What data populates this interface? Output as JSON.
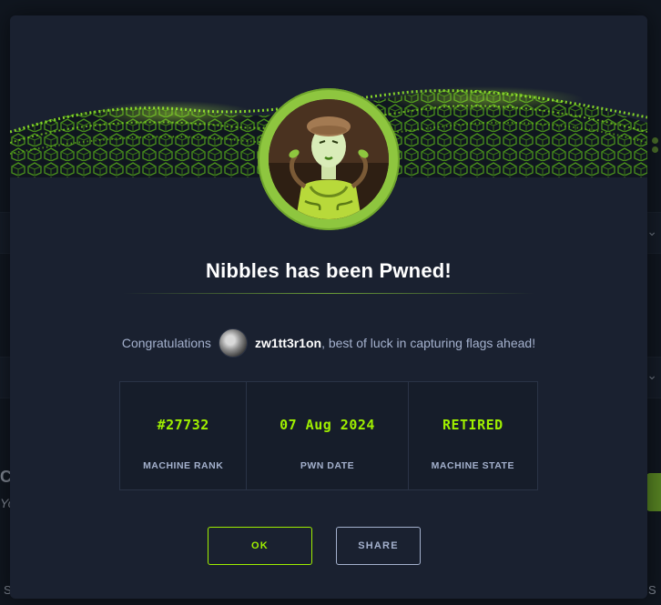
{
  "modal": {
    "title": "Nibbles has been Pwned!",
    "congrats": {
      "prefix": "Congratulations",
      "username": "zw1tt3r1on",
      "suffix": ", best of luck in capturing flags ahead!"
    },
    "stats": [
      {
        "value": "#27732",
        "label": "MACHINE RANK"
      },
      {
        "value": "07 Aug 2024",
        "label": "PWN DATE"
      },
      {
        "value": "RETIRED",
        "label": "MACHINE STATE"
      }
    ],
    "buttons": {
      "ok_label": "OK",
      "share_label": "SHARE"
    }
  },
  "background": {
    "letters": [
      "C",
      "Yo",
      "S",
      "S"
    ]
  },
  "colors": {
    "accent": "#9fef00",
    "ring": "#8ec63f",
    "modal_bg": "#1a2130",
    "muted_text": "#a4b1cd"
  }
}
